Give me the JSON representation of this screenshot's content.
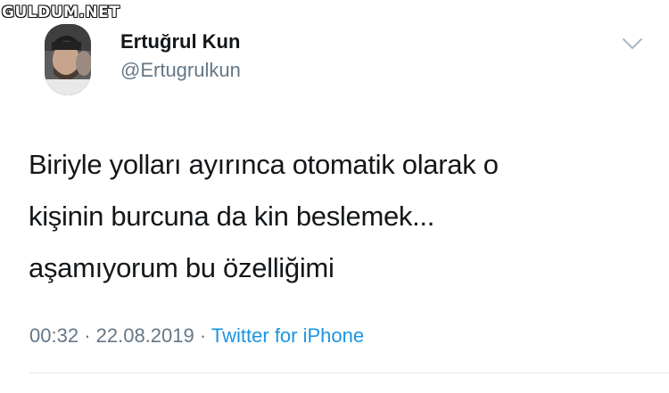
{
  "watermark": {
    "text": "GULDUM.NET"
  },
  "tweet": {
    "author": {
      "display_name": "Ertuğrul Kun",
      "handle": "@Ertugrulkun"
    },
    "text_lines": [
      "Biriyle yolları ayırınca otomatik olarak o",
      "kişinin burcuna da kin beslemek...",
      "aşamıyorum bu özelliğimi"
    ],
    "time": "00:32",
    "separator": "·",
    "date": "22.08.2019",
    "source": "Twitter for iPhone"
  },
  "icons": {
    "menu": "chevron-down-icon"
  },
  "colors": {
    "primary_text": "#14171a",
    "secondary_text": "#657786",
    "link": "#1b95e0",
    "divider": "#e1e8ed"
  }
}
